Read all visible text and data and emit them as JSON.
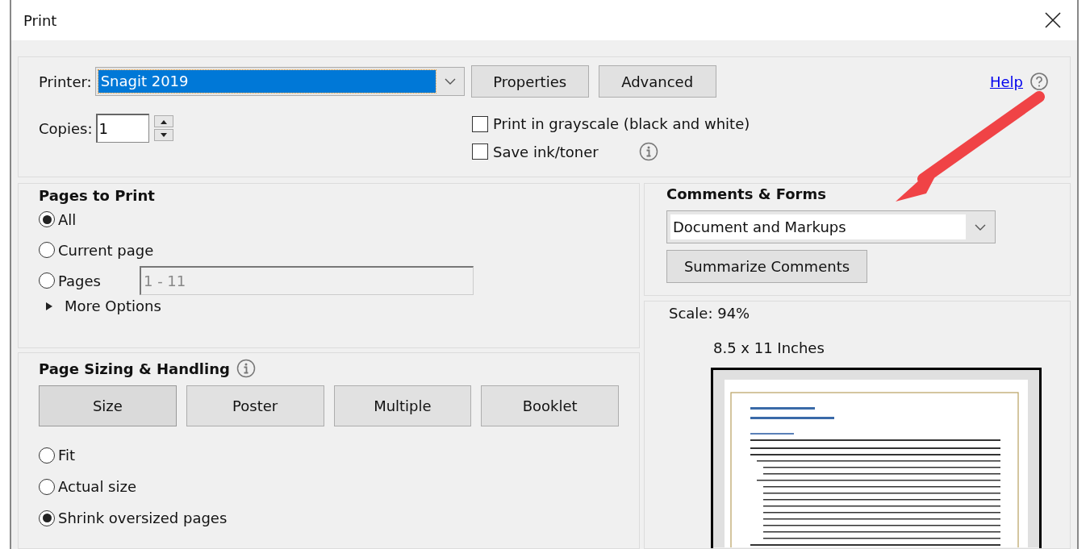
{
  "window": {
    "title": "Print"
  },
  "printer": {
    "label": "Printer:",
    "value": "Snagit 2019",
    "buttons": [
      "Properties",
      "Advanced"
    ]
  },
  "copies": {
    "label": "Copies:",
    "value": "1"
  },
  "help": {
    "link": "Help"
  },
  "options": [
    {
      "label": "Print in grayscale (black and white)",
      "checked": false,
      "info": false
    },
    {
      "label": "Save ink/toner",
      "checked": false,
      "info": true
    }
  ],
  "pages_to_print": {
    "title": "Pages to Print",
    "choices": [
      {
        "label": "All",
        "selected": true
      },
      {
        "label": "Current page",
        "selected": false
      },
      {
        "label": "Pages",
        "selected": false,
        "field": "1 - 11"
      }
    ],
    "more_options": {
      "label": "More Options",
      "expanded": false
    }
  },
  "page_sizing": {
    "title": "Page Sizing & Handling",
    "modes": [
      {
        "label": "Size",
        "selected": true
      },
      {
        "label": "Poster",
        "selected": false
      },
      {
        "label": "Multiple",
        "selected": false
      },
      {
        "label": "Booklet",
        "selected": false
      }
    ],
    "choices": [
      {
        "label": "Fit",
        "selected": false
      },
      {
        "label": "Actual size",
        "selected": false
      },
      {
        "label": "Shrink oversized pages",
        "selected": true
      }
    ]
  },
  "comments_forms": {
    "title": "Comments & Forms",
    "value": "Document and Markups",
    "button": "Summarize Comments"
  },
  "preview": {
    "scale": "Scale:  94%",
    "paper": "8.5 x 11 Inches"
  }
}
